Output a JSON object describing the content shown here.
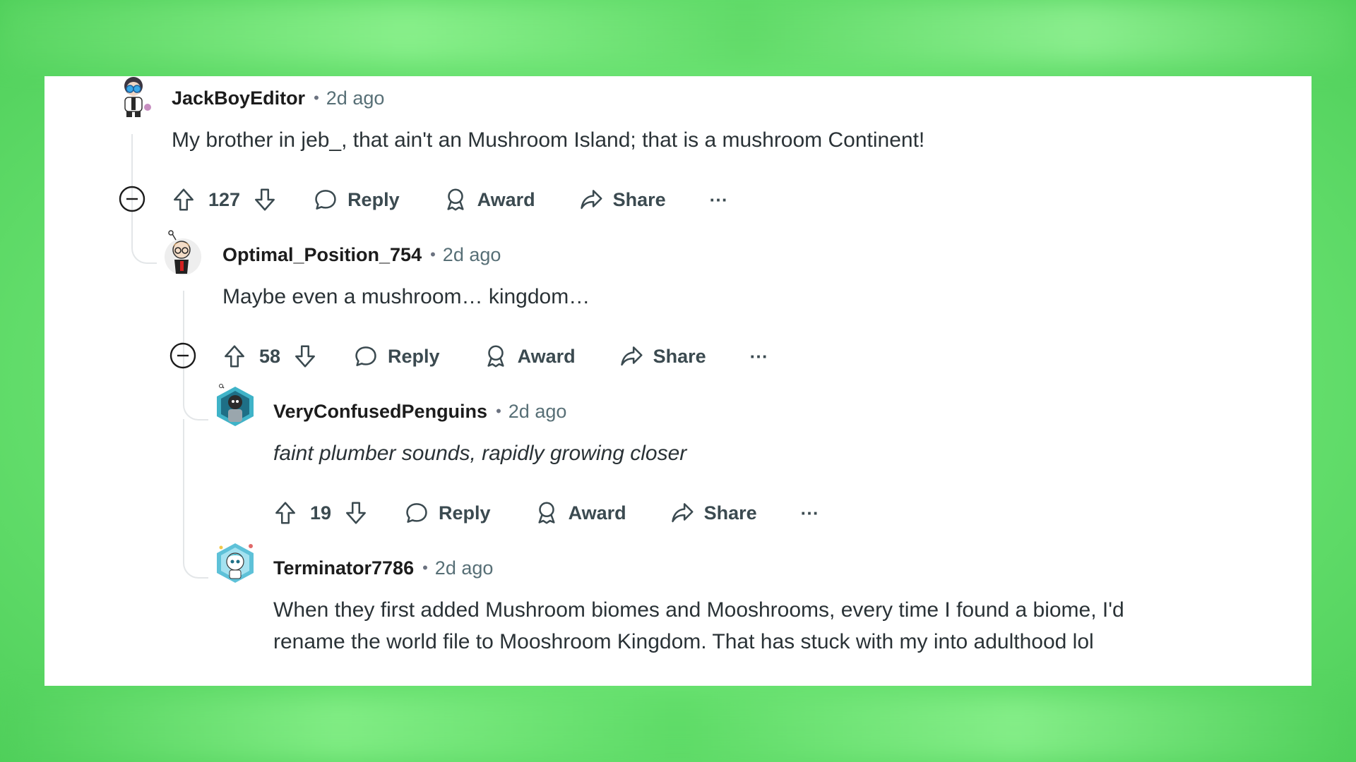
{
  "colors": {
    "background": "#6fe676",
    "card": "#ffffff",
    "text_primary": "#1c1c1c",
    "text_secondary": "#576f76",
    "thread_line": "#e3e6e8"
  },
  "comments": [
    {
      "username": "JackBoyEditor",
      "separator": "•",
      "time": "2d ago",
      "body": "My brother in jeb_, that ain't an Mushroom Island; that is a mushroom Continent!",
      "score": "127",
      "reply_label": "Reply",
      "award_label": "Award",
      "share_label": "Share",
      "more_label": "···",
      "avatar_icon": "avatar-icon"
    },
    {
      "username": "Optimal_Position_754",
      "separator": "•",
      "time": "2d ago",
      "body": "Maybe even a mushroom… kingdom…",
      "score": "58",
      "reply_label": "Reply",
      "award_label": "Award",
      "share_label": "Share",
      "more_label": "···",
      "avatar_icon": "avatar-icon"
    },
    {
      "username": "VeryConfusedPenguins",
      "separator": "•",
      "time": "2d ago",
      "body": "faint plumber sounds, rapidly growing closer",
      "score": "19",
      "reply_label": "Reply",
      "award_label": "Award",
      "share_label": "Share",
      "more_label": "···",
      "avatar_icon": "avatar-icon"
    },
    {
      "username": "Terminator7786",
      "separator": "•",
      "time": "2d ago",
      "body_line1": "When they first added Mushroom biomes and Mooshrooms, every time I found a biome, I'd",
      "body_line2": "rename the world file to Mooshroom Kingdom. That has stuck with my into adulthood lol",
      "avatar_icon": "avatar-icon"
    }
  ]
}
